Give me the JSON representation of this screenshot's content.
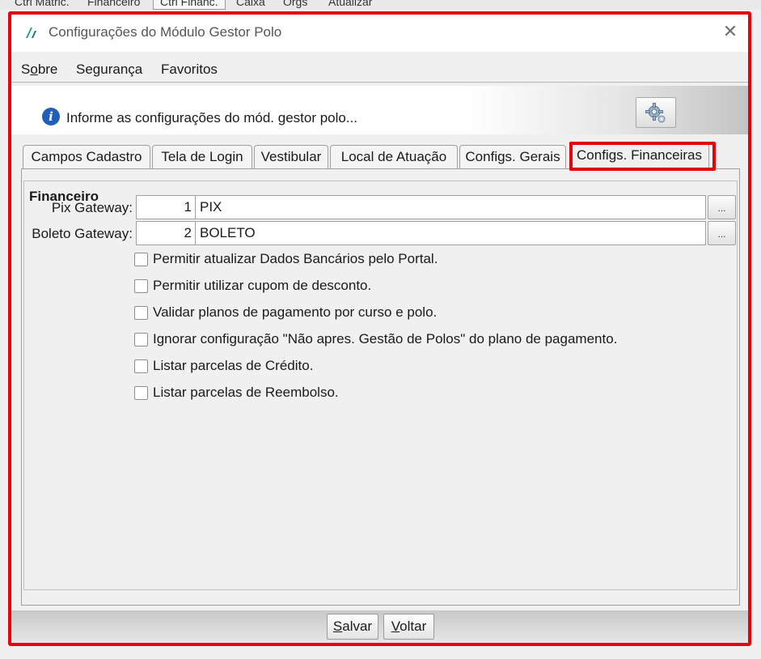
{
  "parent": {
    "tabs": [
      "Ctrl Matric.",
      "Financeiro",
      "Ctrl Financ.",
      "Caixa",
      "Orgs",
      "Atualizar"
    ]
  },
  "window": {
    "title": "Configurações do Módulo Gestor Polo",
    "close_glyph": "✕"
  },
  "menu": {
    "items": [
      {
        "prefix": "S",
        "underline": "o",
        "rest": "bre"
      },
      {
        "prefix": "",
        "underline": "",
        "rest": "Segurança"
      },
      {
        "prefix": "",
        "underline": "",
        "rest": "Favoritos"
      }
    ]
  },
  "info": {
    "text": "Informe as configurações do mód. gestor polo..."
  },
  "tabs": [
    {
      "label": "Campos Cadastro"
    },
    {
      "label": "Tela de Login"
    },
    {
      "label": "Vestibular"
    },
    {
      "label": "Local de Atuação"
    },
    {
      "label": "Configs. Gerais"
    },
    {
      "label": "Configs. Financeiras",
      "active": true
    }
  ],
  "financeiro": {
    "group_title": "Financeiro",
    "pix": {
      "label": "Pix Gateway:",
      "code": "1",
      "name": "PIX",
      "lookup": "..."
    },
    "boleto": {
      "label": "Boleto Gateway:",
      "code": "2",
      "name": "BOLETO",
      "lookup": "..."
    },
    "options": [
      {
        "label": "Permitir atualizar Dados Bancários pelo Portal.",
        "checked": false
      },
      {
        "label": "Permitir utilizar cupom de desconto.",
        "checked": false
      },
      {
        "label": "Validar planos de pagamento por curso e polo.",
        "checked": false
      },
      {
        "label": "Ignorar configuração \"Não apres. Gestão de Polos\" do plano de pagamento.",
        "checked": false
      },
      {
        "label": "Listar parcelas de Crédito.",
        "checked": false
      },
      {
        "label": "Listar parcelas de Reembolso.",
        "checked": false
      }
    ]
  },
  "footer": {
    "save": {
      "underline": "S",
      "rest": "alvar"
    },
    "back": {
      "underline": "V",
      "rest": "oltar"
    }
  },
  "colors": {
    "highlight": "#e8000b",
    "info_icon": "#1f5fb8"
  }
}
